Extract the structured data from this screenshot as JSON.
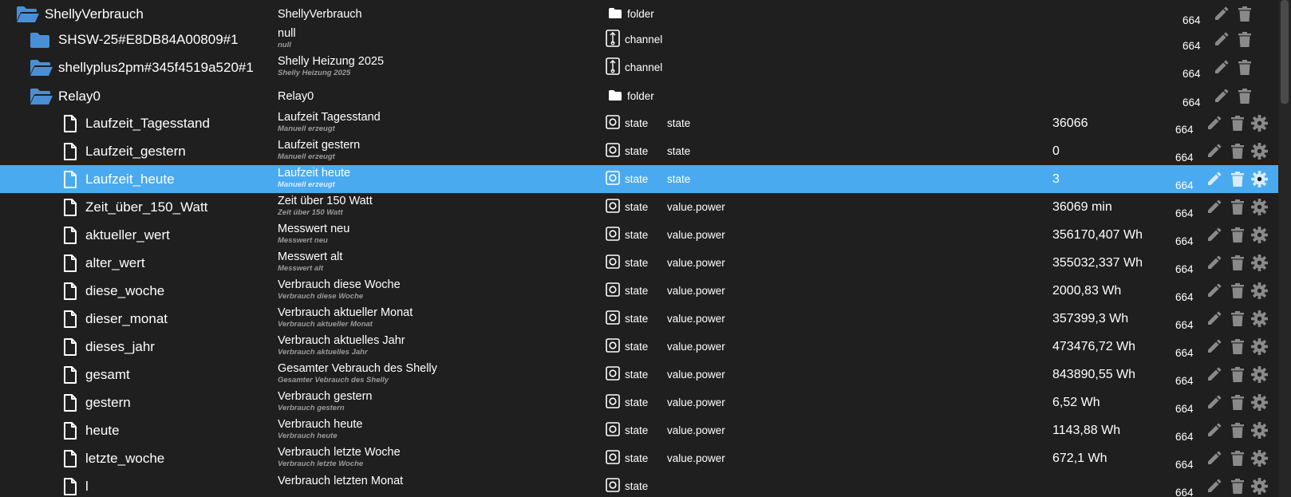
{
  "rows": [
    {
      "id": "ShellyVerbrauch",
      "kind": "folder-open",
      "indent": 0,
      "title": "ShellyVerbrauch",
      "subtitle": "",
      "type": "folder",
      "role": "",
      "value": "",
      "acl": "664",
      "settings": false,
      "selected": false
    },
    {
      "id": "SHSW-25#E8DB84A00809#1",
      "kind": "folder-closed",
      "indent": 1,
      "title": "null",
      "subtitle": "null",
      "type": "channel",
      "role": "",
      "value": "",
      "acl": "664",
      "settings": false,
      "selected": false
    },
    {
      "id": "shellyplus2pm#345f4519a520#1",
      "kind": "folder-open",
      "indent": 1,
      "title": "Shelly Heizung 2025",
      "subtitle": "Shelly Heizung 2025",
      "type": "channel",
      "role": "",
      "value": "",
      "acl": "664",
      "settings": false,
      "selected": false
    },
    {
      "id": "Relay0",
      "kind": "folder-open",
      "indent": 2,
      "title": "Relay0",
      "subtitle": "",
      "type": "folder",
      "role": "",
      "value": "",
      "acl": "664",
      "settings": false,
      "selected": false
    },
    {
      "id": "Laufzeit_Tagesstand",
      "kind": "file",
      "indent": 3,
      "title": "Laufzeit Tagesstand",
      "subtitle": "Manuell erzeugt",
      "type": "state",
      "role": "state",
      "value": "36066",
      "acl": "664",
      "settings": true,
      "selected": false
    },
    {
      "id": "Laufzeit_gestern",
      "kind": "file",
      "indent": 3,
      "title": "Laufzeit gestern",
      "subtitle": "Manuell erzeugt",
      "type": "state",
      "role": "state",
      "value": "0",
      "acl": "664",
      "settings": true,
      "selected": false
    },
    {
      "id": "Laufzeit_heute",
      "kind": "file",
      "indent": 3,
      "title": "Laufzeit heute",
      "subtitle": "Manuell erzeugt",
      "type": "state",
      "role": "state",
      "value": "3",
      "acl": "664",
      "settings": true,
      "selected": true
    },
    {
      "id": "Zeit_über_150_Watt",
      "kind": "file",
      "indent": 3,
      "title": "Zeit über 150 Watt",
      "subtitle": "Zeit über 150 Watt",
      "type": "state",
      "role": "value.power",
      "value": "36069 min",
      "acl": "664",
      "settings": true,
      "selected": false
    },
    {
      "id": "aktueller_wert",
      "kind": "file",
      "indent": 3,
      "title": "Messwert neu",
      "subtitle": "Messwert neu",
      "type": "state",
      "role": "value.power",
      "value": "356170,407 Wh",
      "acl": "664",
      "settings": true,
      "selected": false
    },
    {
      "id": "alter_wert",
      "kind": "file",
      "indent": 3,
      "title": "Messwert alt",
      "subtitle": "Messwert alt",
      "type": "state",
      "role": "value.power",
      "value": "355032,337 Wh",
      "acl": "664",
      "settings": true,
      "selected": false
    },
    {
      "id": "diese_woche",
      "kind": "file",
      "indent": 3,
      "title": "Verbrauch diese Woche",
      "subtitle": "Verbrauch diese Woche",
      "type": "state",
      "role": "value.power",
      "value": "2000,83 Wh",
      "acl": "664",
      "settings": true,
      "selected": false
    },
    {
      "id": "dieser_monat",
      "kind": "file",
      "indent": 3,
      "title": "Verbrauch aktueller Monat",
      "subtitle": "Verbrauch aktueller Monat",
      "type": "state",
      "role": "value.power",
      "value": "357399,3 Wh",
      "acl": "664",
      "settings": true,
      "selected": false
    },
    {
      "id": "dieses_jahr",
      "kind": "file",
      "indent": 3,
      "title": "Verbrauch aktuelles Jahr",
      "subtitle": "Verbrauch aktuelles Jahr",
      "type": "state",
      "role": "value.power",
      "value": "473476,72 Wh",
      "acl": "664",
      "settings": true,
      "selected": false
    },
    {
      "id": "gesamt",
      "kind": "file",
      "indent": 3,
      "title": "Gesamter Vebrauch des Shelly",
      "subtitle": "Gesamter Vebrauch des Shelly",
      "type": "state",
      "role": "value.power",
      "value": "843890,55 Wh",
      "acl": "664",
      "settings": true,
      "selected": false
    },
    {
      "id": "gestern",
      "kind": "file",
      "indent": 3,
      "title": "Verbrauch gestern",
      "subtitle": "Verbrauch gestern",
      "type": "state",
      "role": "value.power",
      "value": "6,52 Wh",
      "acl": "664",
      "settings": true,
      "selected": false
    },
    {
      "id": "heute",
      "kind": "file",
      "indent": 3,
      "title": "Verbrauch heute",
      "subtitle": "Verbrauch heute",
      "type": "state",
      "role": "value.power",
      "value": "1143,88 Wh",
      "acl": "664",
      "settings": true,
      "selected": false
    },
    {
      "id": "letzte_woche",
      "kind": "file",
      "indent": 3,
      "title": "Verbrauch letzte Woche",
      "subtitle": "Verbrauch letzte Woche",
      "type": "state",
      "role": "value.power",
      "value": "672,1 Wh",
      "acl": "664",
      "settings": true,
      "selected": false
    },
    {
      "id": "l",
      "kind": "file",
      "indent": 3,
      "title": "Verbrauch letzten Monat",
      "subtitle": "",
      "type": "state",
      "role": "",
      "value": "",
      "acl": "664",
      "settings": true,
      "selected": false
    }
  ],
  "colors": {
    "background": "#1f1f1f",
    "selected": "#4aaaf0",
    "folder": "#4a8fd6",
    "icon_gray": "#8a8a8a"
  }
}
